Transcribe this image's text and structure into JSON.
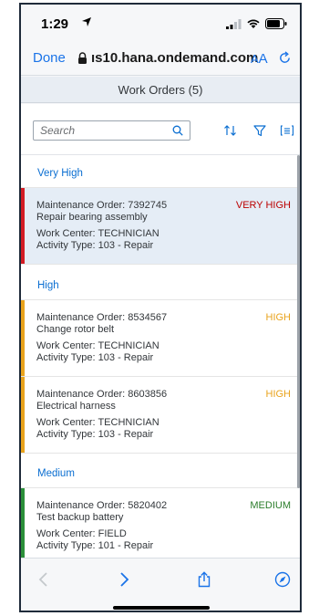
{
  "status": {
    "time": "1:29"
  },
  "browser": {
    "done_label": "Done",
    "url": "ıs10.hana.ondemand.com",
    "aa_small": "A",
    "aa_big": "A"
  },
  "app": {
    "title": "Work Orders (5)"
  },
  "search": {
    "placeholder": "Search"
  },
  "groups": [
    {
      "label": "Very High"
    },
    {
      "label": "High"
    },
    {
      "label": "Medium"
    }
  ],
  "items": [
    {
      "order": "Maintenance Order: 7392745",
      "description": "Repair bearing assembly",
      "work_center": "Work Center: TECHNICIAN",
      "activity": "Activity Type: 103 - Repair",
      "priority": "VERY HIGH",
      "priority_color": "#bb0000"
    },
    {
      "order": "Maintenance Order: 8534567",
      "description": "Change rotor belt",
      "work_center": "Work Center: TECHNICIAN",
      "activity": "Activity Type: 103 - Repair",
      "priority": "HIGH",
      "priority_color": "#e9a31c"
    },
    {
      "order": "Maintenance Order: 8603856",
      "description": "Electrical harness",
      "work_center": "Work Center: TECHNICIAN",
      "activity": "Activity Type: 103 - Repair",
      "priority": "HIGH",
      "priority_color": "#e9a31c"
    },
    {
      "order": "Maintenance Order: 5820402",
      "description": "Test backup battery",
      "work_center": "Work Center: FIELD",
      "activity": "Activity Type: 101 - Repair",
      "priority": "MEDIUM",
      "priority_color": "#2b7d2b"
    }
  ],
  "colors": {
    "accent": "#0a6ed1",
    "ios_blue": "#1a73e8",
    "very_high_bar": "#d41c24",
    "high_bar": "#e9a31c",
    "medium_bar": "#2b8f3a",
    "selected_row": "#e5edf6"
  },
  "icons": {
    "location": "location-arrow-icon",
    "signal": "signal-icon",
    "wifi": "wifi-icon",
    "battery": "battery-icon",
    "lock": "lock-icon",
    "reload": "reload-icon",
    "search": "search-icon",
    "sort": "sort-icon",
    "filter": "filter-icon",
    "group": "group-icon",
    "back": "chevron-left-icon",
    "forward": "chevron-right-icon",
    "share": "share-icon",
    "compass": "compass-icon"
  }
}
